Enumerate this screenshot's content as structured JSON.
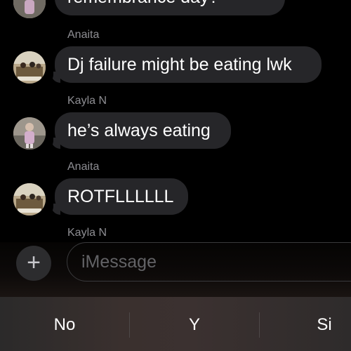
{
  "thread": {
    "partial_message": {
      "text": "remembrance day?"
    },
    "messages": [
      {
        "sender": "Anaita",
        "text": "Dj failure might be eating lwk"
      },
      {
        "sender": "Kayla N",
        "text": "he’s always eating"
      },
      {
        "sender": "Anaita",
        "text": "ROTFLLLLLL"
      }
    ],
    "partial_sender": "Kayla N"
  },
  "composer": {
    "plus_icon": "plus-icon",
    "placeholder": "iMessage"
  },
  "keyboard": {
    "suggestions": [
      "No",
      "Y",
      "Si"
    ]
  }
}
